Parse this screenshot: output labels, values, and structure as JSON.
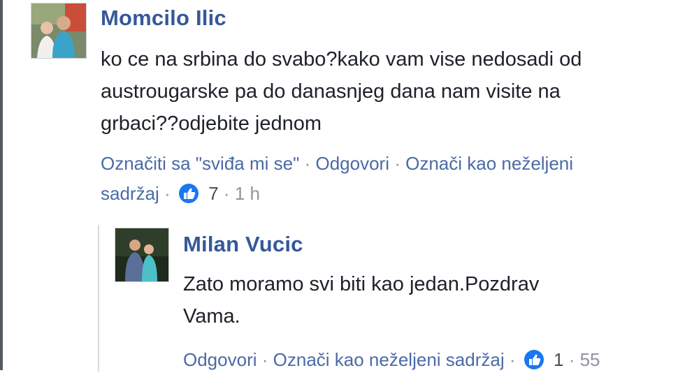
{
  "comment": {
    "author": "Momcilo Ilic",
    "text_lines": [
      "ko ce na srbina do svabo?kako vam vise nedosadi od",
      "austrougarske pa do danasnjeg dana nam visite na",
      "grbaci??odjebite jednom"
    ],
    "like_label": "Označiti sa \"sviđa mi se\"",
    "reply_label": "Odgovori",
    "report_label_line1": "Označi kao neželjeni",
    "report_label_line2": "sadržaj",
    "separator": "·",
    "like_count": "7",
    "timestamp": "1 h"
  },
  "reply": {
    "author": "Milan Vucic",
    "text_lines": [
      "Zato moramo svi biti kao jedan.Pozdrav",
      "Vama."
    ],
    "reply_label": "Odgovori",
    "report_label": "Označi kao neželjeni sadržaj",
    "separator": "·",
    "like_count": "1",
    "timestamp": "55"
  },
  "icons": {
    "like": "like-icon",
    "avatar": "avatar"
  },
  "colors": {
    "name": "#365899",
    "link": "#4b6aa6",
    "muted": "#90949c",
    "like_icon": "#1877f2"
  }
}
